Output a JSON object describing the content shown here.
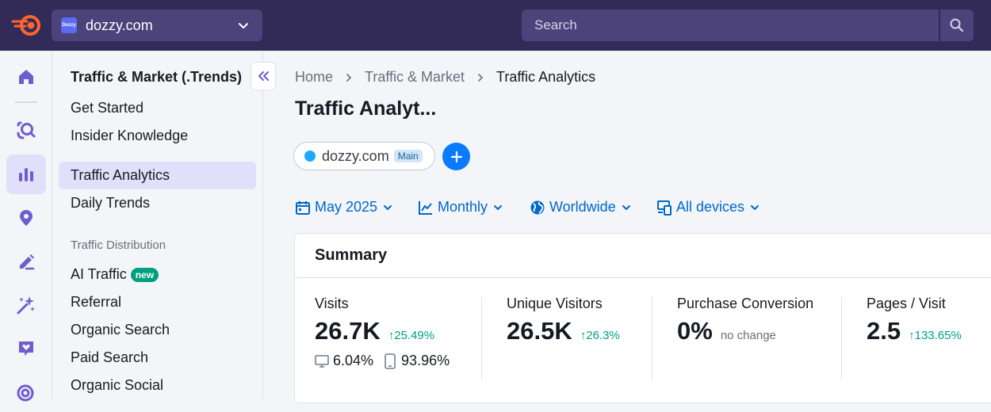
{
  "header": {
    "project": {
      "favicon_text": "Dozzy",
      "name": "dozzy.com"
    },
    "search": {
      "placeholder": "Search"
    }
  },
  "rail": {
    "items": [
      {
        "icon": "home-icon"
      },
      {
        "icon": "seo-icon"
      },
      {
        "icon": "traffic-bar-chart-icon",
        "active": true
      },
      {
        "icon": "location-pin-icon"
      },
      {
        "icon": "content-edit-icon"
      },
      {
        "icon": "ai-sparkle-icon"
      },
      {
        "icon": "social-heart-icon"
      },
      {
        "icon": "ads-target-icon"
      }
    ]
  },
  "sidebar": {
    "title": "Traffic & Market (.Trends)",
    "items": [
      {
        "label": "Get Started"
      },
      {
        "label": "Insider Knowledge"
      },
      {
        "label": "Traffic Analytics",
        "active": true
      },
      {
        "label": "Daily Trends"
      }
    ],
    "group_label": "Traffic Distribution",
    "group_items": [
      {
        "label": "AI Traffic",
        "badge": "new"
      },
      {
        "label": "Referral"
      },
      {
        "label": "Organic Search"
      },
      {
        "label": "Paid Search"
      },
      {
        "label": "Organic Social"
      }
    ]
  },
  "breadcrumb": [
    "Home",
    "Traffic & Market",
    "Traffic Analytics"
  ],
  "page_title": "Traffic Analyt...",
  "domain_chip": {
    "name": "dozzy.com",
    "tag": "Main"
  },
  "filters": {
    "date": "May 2025",
    "granularity": "Monthly",
    "region": "Worldwide",
    "device": "All devices"
  },
  "summary": {
    "title": "Summary",
    "visits": {
      "label": "Visits",
      "value": "26.7K",
      "delta": "25.49%",
      "desktop_share": "6.04%",
      "mobile_share": "93.96%"
    },
    "unique_visitors": {
      "label": "Unique Visitors",
      "value": "26.5K",
      "delta": "26.3%"
    },
    "purchase_conversion": {
      "label": "Purchase Conversion",
      "value": "0%",
      "note": "no change"
    },
    "pages_per_visit": {
      "label": "Pages / Visit",
      "value": "2.5",
      "delta": "133.65%"
    }
  },
  "colors": {
    "topbar": "#322b57",
    "topbar_control": "#4b437a",
    "accent_purple": "#6c5ecf",
    "link_blue": "#0068c9",
    "positive_green": "#009f81",
    "brand_orange": "#ff642d"
  }
}
